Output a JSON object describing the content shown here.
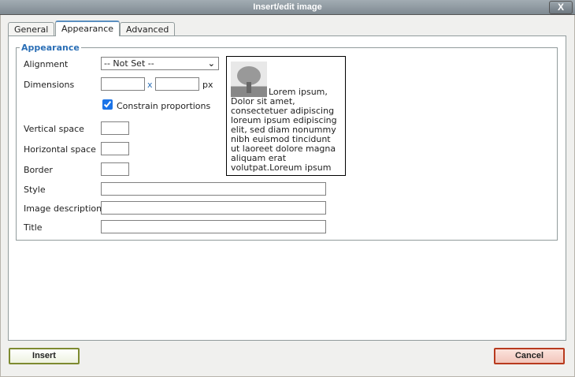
{
  "window": {
    "title": "Insert/edit image",
    "close_label": "X"
  },
  "tabs": [
    {
      "label": "General"
    },
    {
      "label": "Appearance"
    },
    {
      "label": "Advanced"
    }
  ],
  "appearance": {
    "legend": "Appearance",
    "alignment_label": "Alignment",
    "alignment_value": "-- Not Set --",
    "dimensions_label": "Dimensions",
    "dimensions_x": "x",
    "dimensions_unit": "px",
    "width_value": "",
    "height_value": "",
    "constrain_label": "Constrain proportions",
    "constrain_checked": true,
    "vspace_label": "Vertical space",
    "hspace_label": "Horizontal space",
    "border_label": "Border",
    "style_label": "Style",
    "description_label": "Image description",
    "title_label": "Title",
    "preview_text": "Lorem ipsum, Dolor sit amet, consectetuer adipiscing loreum ipsum edipiscing elit, sed diam nonummy nibh euismod tincidunt ut laoreet dolore magna aliquam erat volutpat.Loreum ipsum"
  },
  "buttons": {
    "insert": "Insert",
    "cancel": "Cancel"
  }
}
